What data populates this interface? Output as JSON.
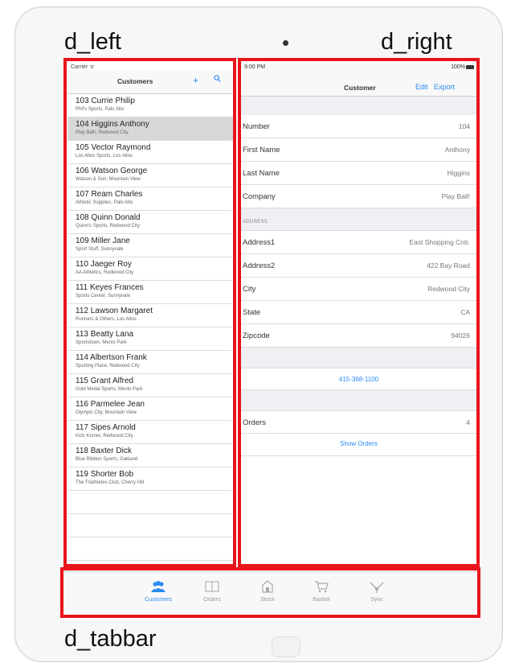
{
  "labels": {
    "left": "d_left",
    "right": "d_right",
    "tabbar": "d_tabbar"
  },
  "left": {
    "carrier": "Carrier ᯤ",
    "title": "Customers",
    "add_icon": "plus-icon",
    "search_icon": "search-icon",
    "customers": [
      {
        "name": "103 Currie Philip",
        "sub": "Phil's Sports, Palo Alto"
      },
      {
        "name": "104 Higgins Anthony",
        "sub": "Play Ball!, Redwood City"
      },
      {
        "name": "105 Vector Raymond",
        "sub": "Los Altos Sports, Los Altos"
      },
      {
        "name": "106 Watson George",
        "sub": "Watson & Son, Mountain View"
      },
      {
        "name": "107 Ream Charles",
        "sub": "Athletic Supplies, Palo Alto"
      },
      {
        "name": "108 Quinn Donald",
        "sub": "Quinn's Sports, Redwood City"
      },
      {
        "name": "109 Miller Jane",
        "sub": "Sport Stuff, Sunnyvale"
      },
      {
        "name": "110 Jaeger Roy",
        "sub": "AA Athletics, Redwood City"
      },
      {
        "name": "111 Keyes Frances",
        "sub": "Sports Center, Sunnyvale"
      },
      {
        "name": "112 Lawson Margaret",
        "sub": "Runners & Others, Los Altos"
      },
      {
        "name": "113 Beatty Lana",
        "sub": "Sportstown, Menlo Park"
      },
      {
        "name": "114 Albertson Frank",
        "sub": "Sporting Place, Redwood City"
      },
      {
        "name": "115 Grant Alfred",
        "sub": "Gold Medal Sports, Menlo Park"
      },
      {
        "name": "116 Parmelee Jean",
        "sub": "Olympic City, Mountain View"
      },
      {
        "name": "117 Sipes Arnold",
        "sub": "Kids Korner, Redwood City"
      },
      {
        "name": "118 Baxter Dick",
        "sub": "Blue Ribbon Sports, Oakland"
      },
      {
        "name": "119 Shorter Bob",
        "sub": "The Triathletes Club, Cherry Hill"
      }
    ]
  },
  "right": {
    "time": "9:00 PM",
    "battery": "100%",
    "title": "Customer",
    "edit": "Edit",
    "export": "Export",
    "fields": [
      {
        "key": "Number",
        "value": "104"
      },
      {
        "key": "First Name",
        "value": "Anthony"
      },
      {
        "key": "Last Name",
        "value": "Higgins"
      },
      {
        "key": "Company",
        "value": "Play Ball!"
      }
    ],
    "address_header": "ADDRESS",
    "address_fields": [
      {
        "key": "Address1",
        "value": "East Shopping Cntr."
      },
      {
        "key": "Address2",
        "value": "422 Bay Road"
      },
      {
        "key": "City",
        "value": "Redwood City"
      },
      {
        "key": "State",
        "value": "CA"
      },
      {
        "key": "Zipcode",
        "value": "94026"
      }
    ],
    "phone": "415-368-1100",
    "orders_label": "Orders",
    "orders_count": "4",
    "show_orders": "Show Orders"
  },
  "tabbar": {
    "tabs": [
      {
        "label": "Customers",
        "icon": "customers-icon",
        "active": true
      },
      {
        "label": "Orders",
        "icon": "orders-icon",
        "active": false
      },
      {
        "label": "Stock",
        "icon": "stock-icon",
        "active": false
      },
      {
        "label": "Basket",
        "icon": "basket-icon",
        "active": false
      },
      {
        "label": "Sync",
        "icon": "sync-icon",
        "active": false
      }
    ]
  },
  "colors": {
    "highlight_box": "#e8141c",
    "accent": "#2a8bf2",
    "selected_row": "#d8d8d8"
  }
}
